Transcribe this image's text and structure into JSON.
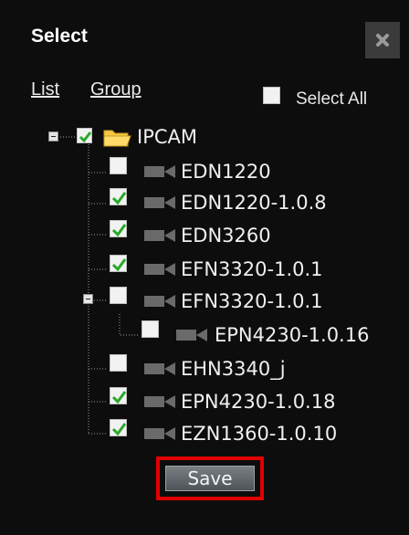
{
  "dialog": {
    "title": "Select",
    "close_icon": "close-icon"
  },
  "tabs": {
    "list_label": "List",
    "group_label": "Group"
  },
  "select_all": {
    "label": "Select All",
    "checked": false
  },
  "tree": {
    "root": {
      "label": "IPCAM",
      "checked": true,
      "expanded": true,
      "icon": "folder-icon"
    },
    "items": [
      {
        "label": "EDN1220",
        "checked": false,
        "icon": "camera-icon"
      },
      {
        "label": "EDN1220-1.0.8",
        "checked": true,
        "icon": "camera-icon"
      },
      {
        "label": "EDN3260",
        "checked": true,
        "icon": "camera-icon"
      },
      {
        "label": "EFN3320-1.0.1",
        "checked": true,
        "icon": "camera-icon"
      },
      {
        "label": "EFN3320-1.0.1",
        "checked": false,
        "expanded": true,
        "icon": "camera-icon",
        "children": [
          {
            "label": "EPN4230-1.0.16",
            "checked": false,
            "icon": "camera-icon"
          }
        ]
      },
      {
        "label": "EHN3340_j",
        "checked": false,
        "icon": "camera-icon"
      },
      {
        "label": "EPN4230-1.0.18",
        "checked": true,
        "icon": "camera-icon"
      },
      {
        "label": "EZN1360-1.0.10",
        "checked": true,
        "icon": "camera-icon"
      }
    ]
  },
  "footer": {
    "save_label": "Save"
  },
  "colors": {
    "background": "#0d0d0d",
    "check_green": "#2aa82a",
    "highlight_red": "#e00000"
  }
}
